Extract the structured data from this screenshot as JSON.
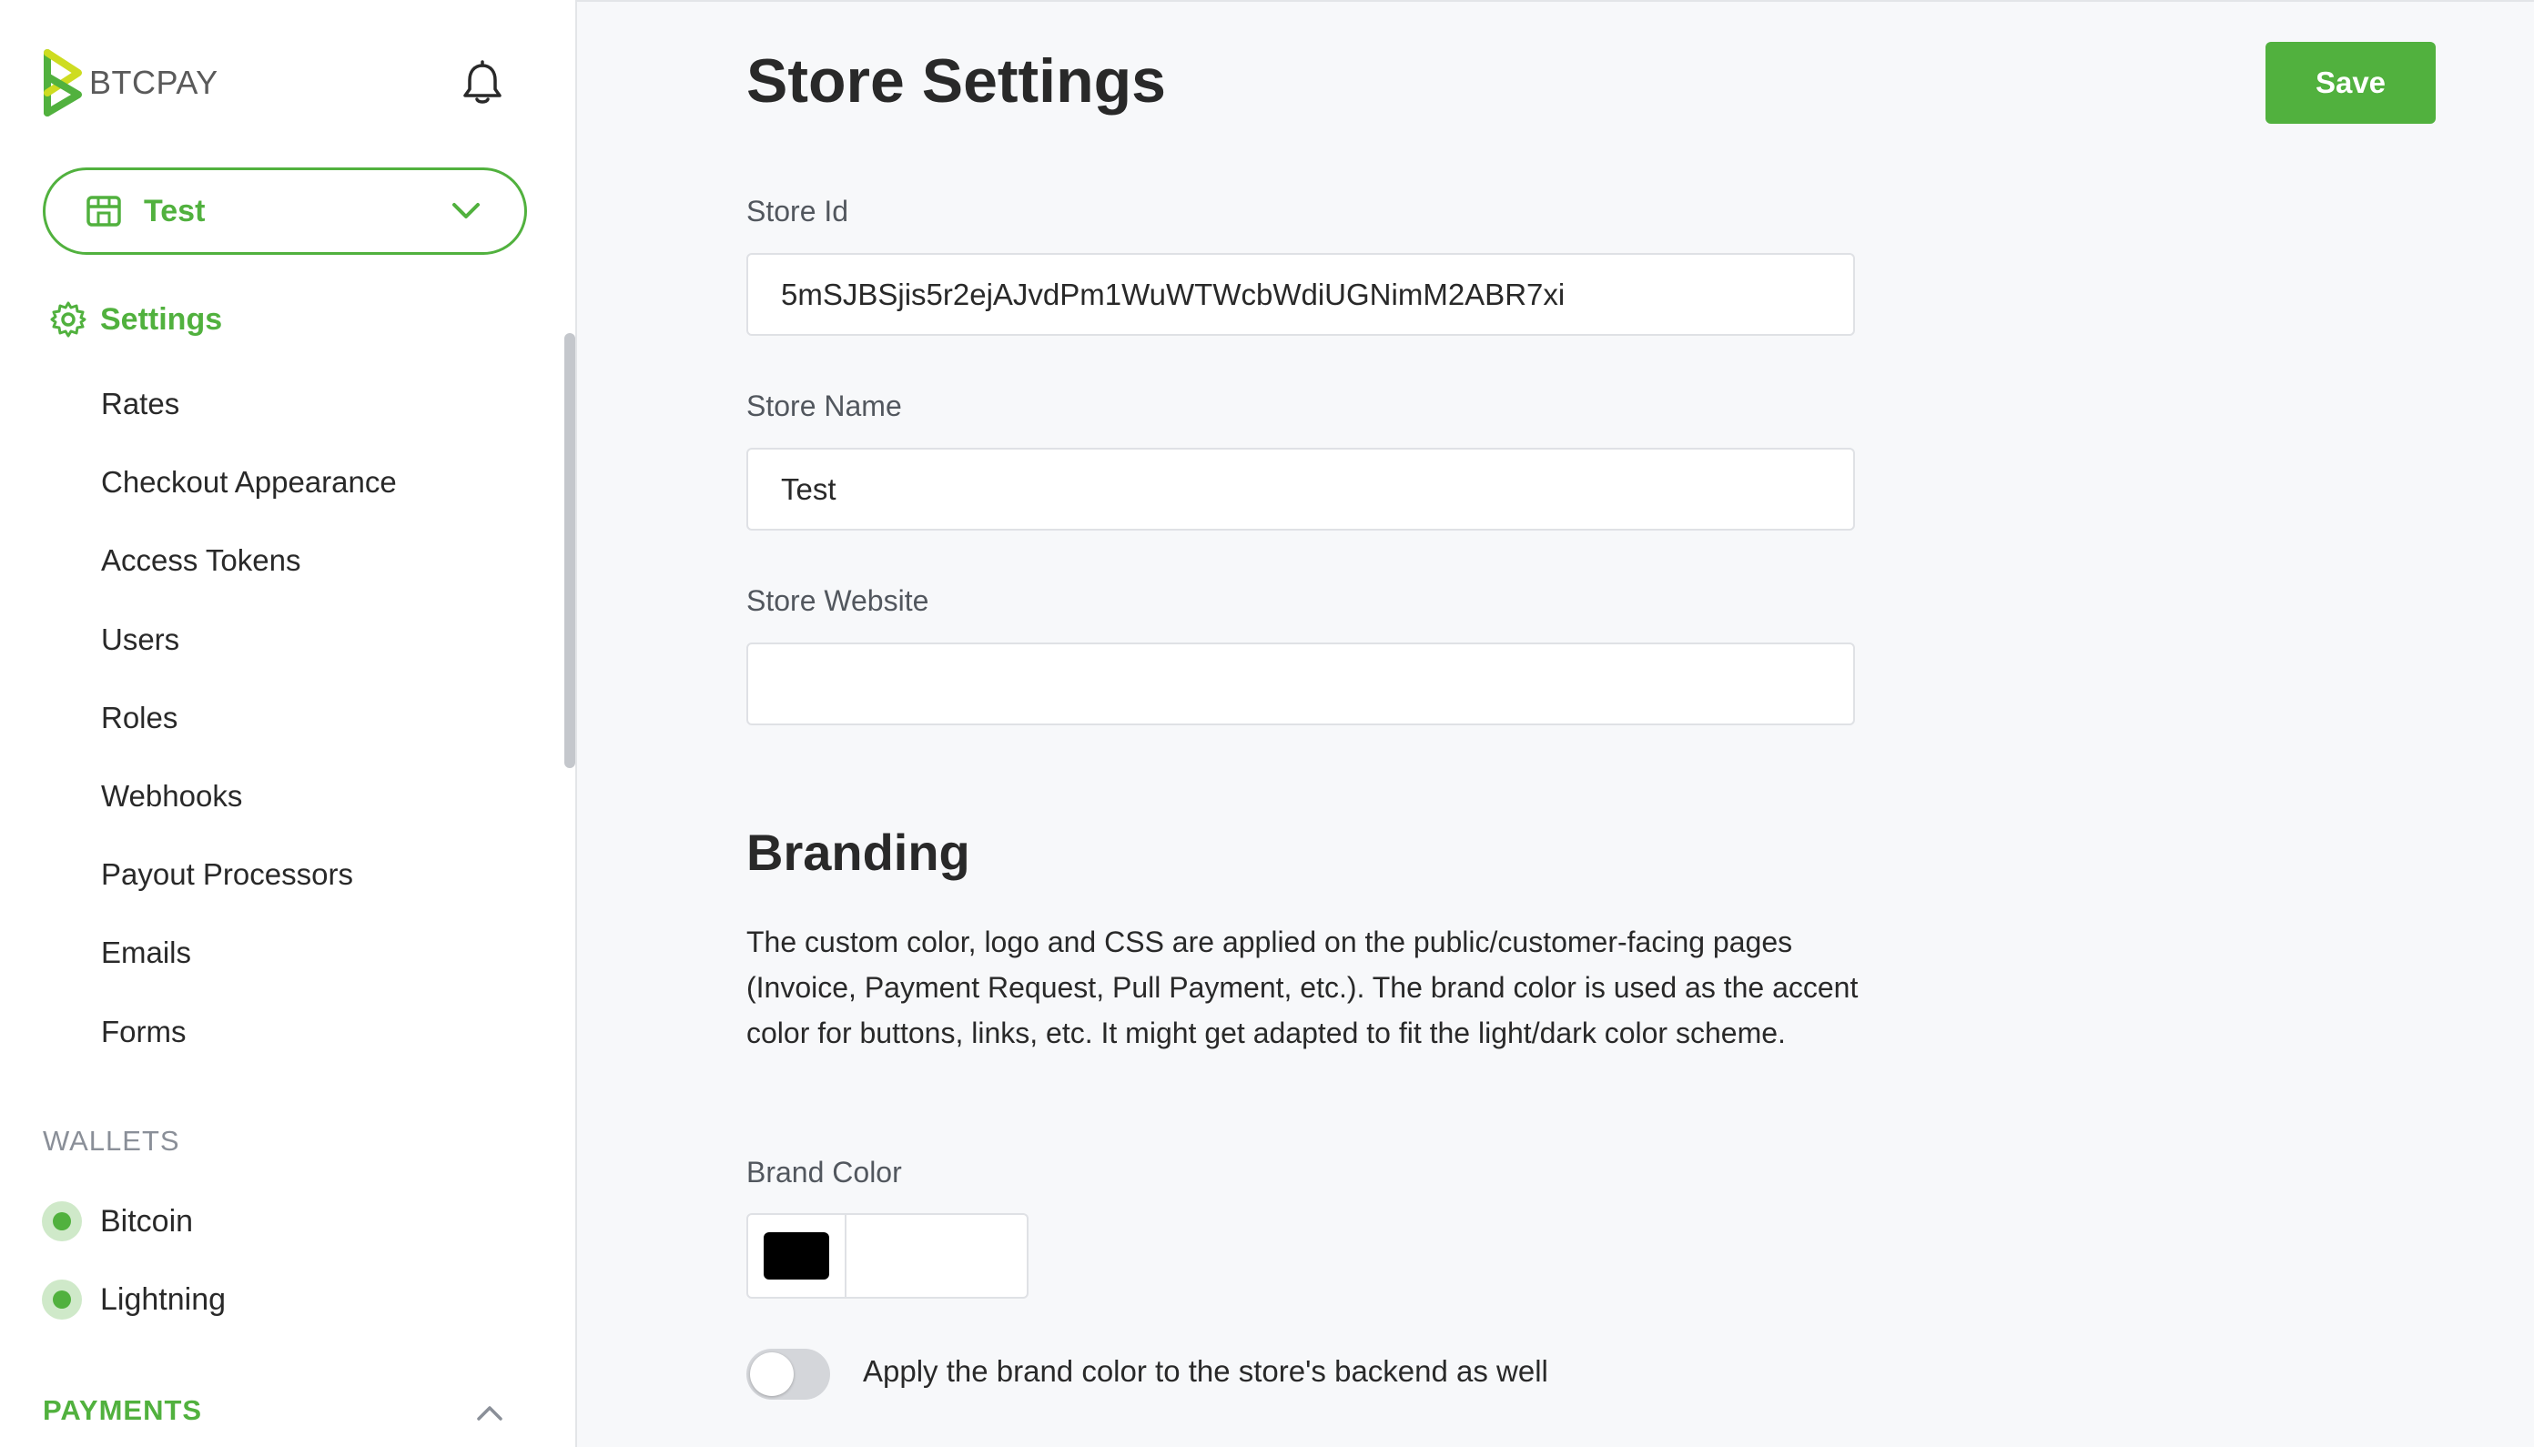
{
  "brand": {
    "name": "BTCPAY",
    "accent_color": "#51b13e"
  },
  "header_icons": {
    "notifications": "bell-icon"
  },
  "store_selector": {
    "current": "Test",
    "icon": "store-icon",
    "chevron": "chevron-down-icon"
  },
  "nav": {
    "settings": {
      "label": "Settings",
      "icon": "gear-icon"
    },
    "sub_items": [
      {
        "label": "Rates"
      },
      {
        "label": "Checkout Appearance"
      },
      {
        "label": "Access Tokens"
      },
      {
        "label": "Users"
      },
      {
        "label": "Roles"
      },
      {
        "label": "Webhooks"
      },
      {
        "label": "Payout Processors"
      },
      {
        "label": "Emails"
      },
      {
        "label": "Forms"
      }
    ],
    "wallets_title": "WALLETS",
    "wallets": [
      {
        "label": "Bitcoin",
        "status_color": "#51b13e"
      },
      {
        "label": "Lightning",
        "status_color": "#51b13e"
      }
    ],
    "payments_title": "PAYMENTS"
  },
  "main": {
    "title": "Store Settings",
    "save_label": "Save",
    "fields": {
      "store_id": {
        "label": "Store Id",
        "value": "5mSJBSjis5r2ejAJvdPm1WuWTWcbWdiUGNimM2ABR7xi"
      },
      "store_name": {
        "label": "Store Name",
        "value": "Test"
      },
      "store_website": {
        "label": "Store Website",
        "value": ""
      }
    },
    "branding": {
      "title": "Branding",
      "description": "The custom color, logo and CSS are applied on the public/customer-facing pages (Invoice, Payment Request, Pull Payment, etc.). The brand color is used as the accent color for buttons, links, etc. It might get adapted to fit the light/dark color scheme.",
      "brand_color_label": "Brand Color",
      "brand_color_value": "",
      "brand_color_swatch": "#000000",
      "apply_backend_label": "Apply the brand color to the store's backend as well",
      "apply_backend_enabled": false
    }
  }
}
